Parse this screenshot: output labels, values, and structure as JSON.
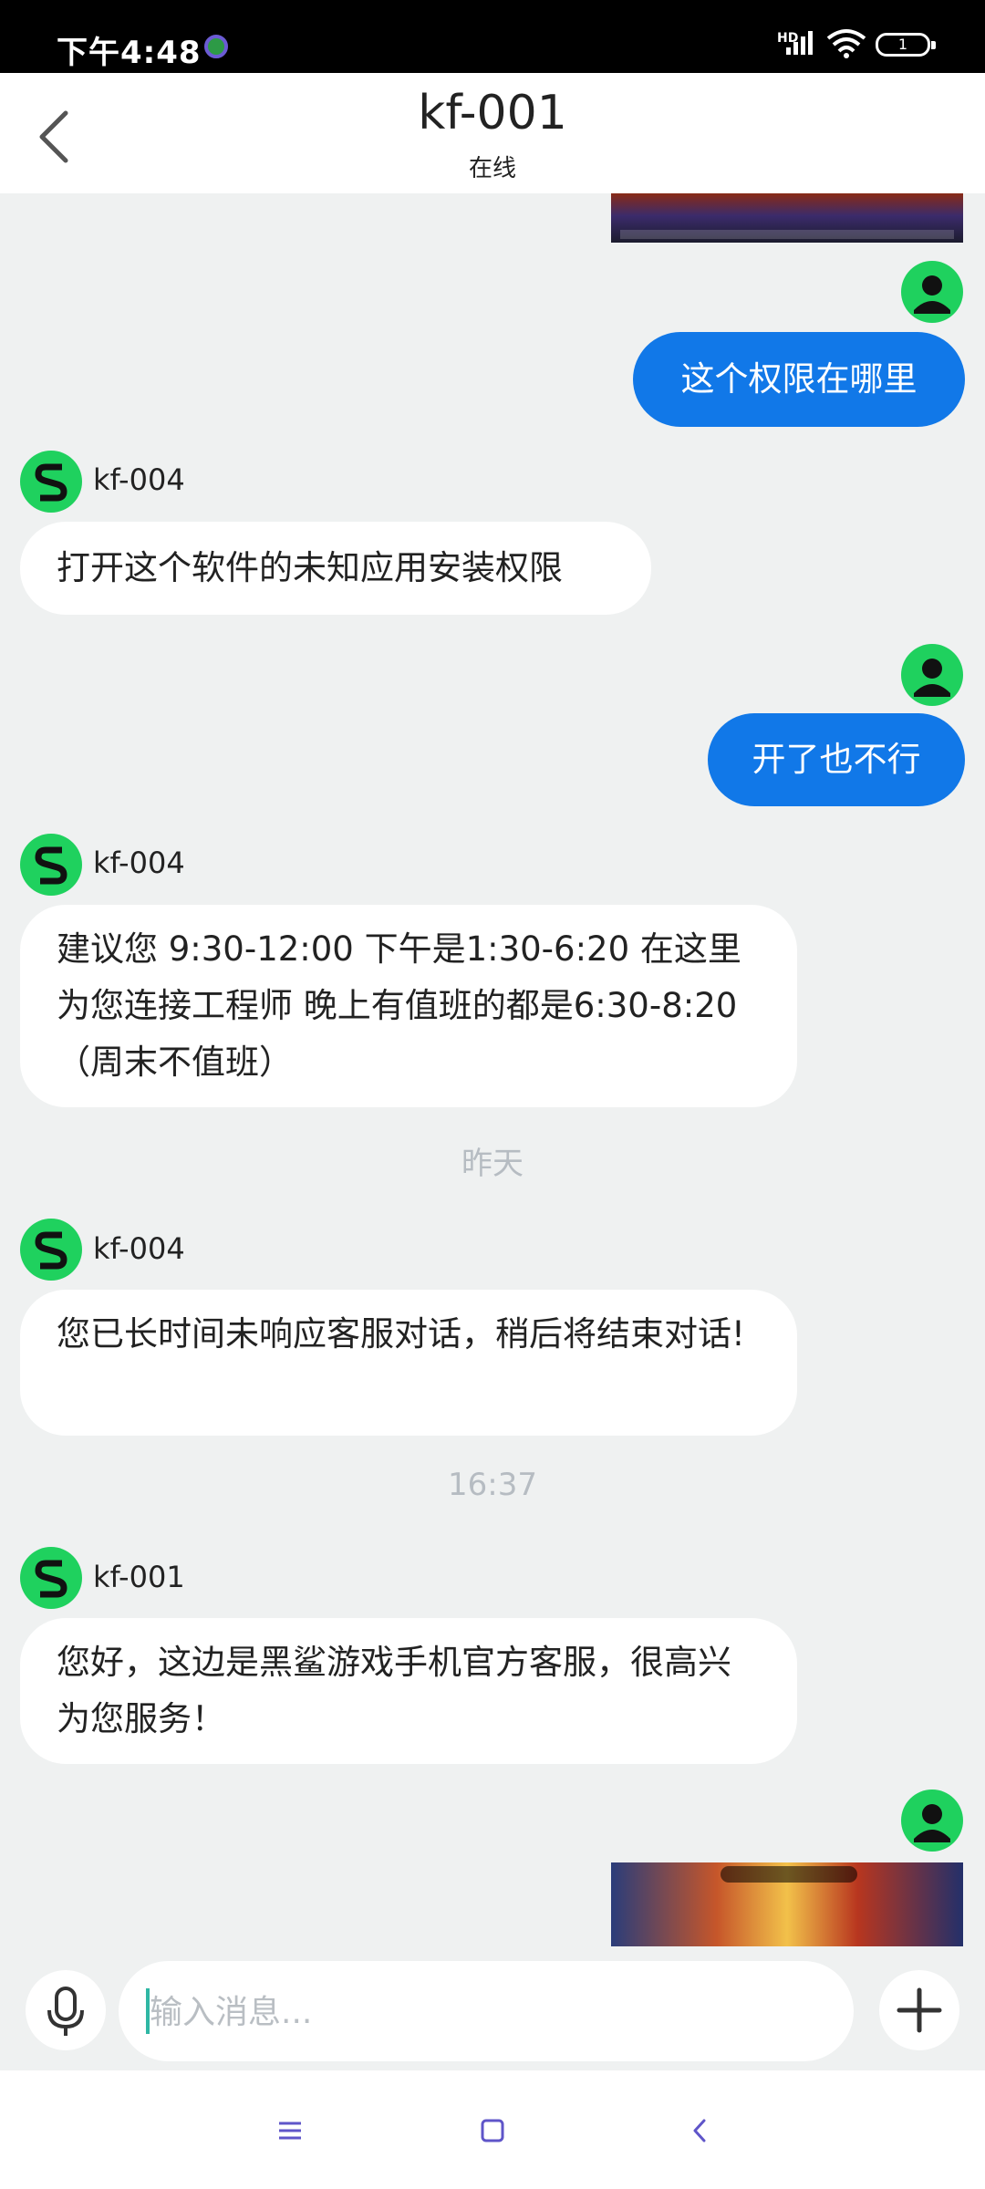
{
  "status_bar": {
    "time": "下午4:48",
    "battery": "1",
    "network": "HD"
  },
  "header": {
    "title": "kf-001",
    "subtitle": "在线"
  },
  "messages": [
    {
      "sender": "kf-004",
      "text": "打开这个软件的未知应用安装权限"
    },
    {
      "sender": "kf-004",
      "text": "建议您 9:30-12:00 下午是1:30-6:20 在这里为您连接工程师 晚上有值班的都是6:30-8:20（周末不值班）"
    },
    {
      "sender": "kf-004",
      "text": "您已长时间未响应客服对话，稍后将结束对话!"
    },
    {
      "sender": "kf-001",
      "text": "您好，这边是黑鲨游戏手机官方客服，很高兴为您服务！"
    }
  ],
  "user_messages": [
    {
      "text": "这个权限在哪里"
    },
    {
      "text": "开了也不行"
    }
  ],
  "timestamps": [
    "昨天",
    "16:37"
  ],
  "input": {
    "placeholder": "输入消息..."
  },
  "colors": {
    "accent": "#1178e8",
    "avatar_green": "#1fd15e",
    "background": "#eff1f1"
  }
}
